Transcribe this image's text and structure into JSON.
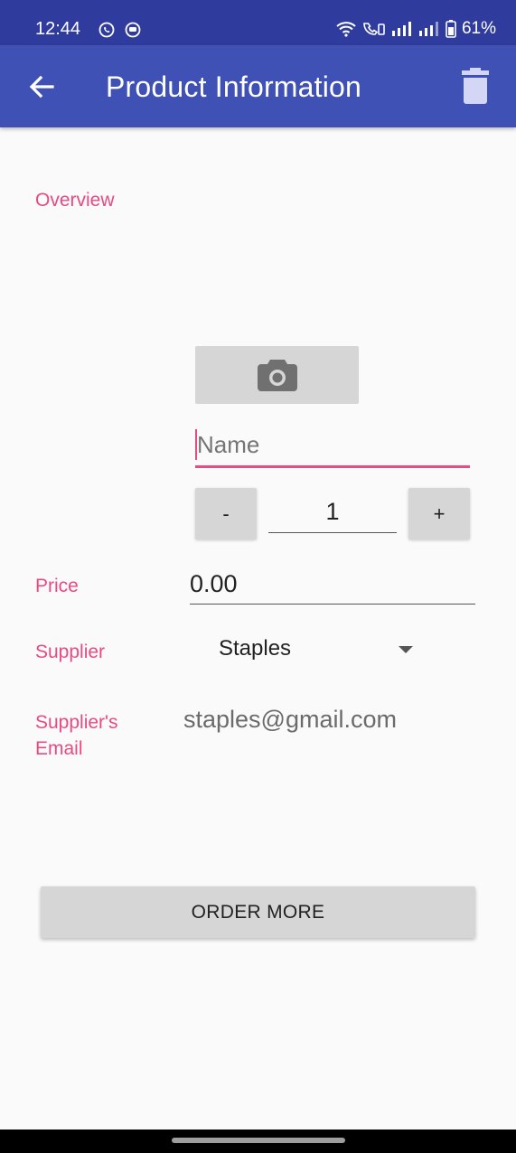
{
  "status_bar": {
    "time": "12:44",
    "left_icons": [
      "whatsapp-icon",
      "notification-app-icon"
    ],
    "right_icons": [
      "wifi-icon",
      "wifi-calling-icon",
      "signal-icon",
      "signal-icon",
      "battery-icon"
    ],
    "battery": "61%"
  },
  "app_bar": {
    "title": "Product Information",
    "back_icon": "arrow-back-icon",
    "delete_icon": "trash-icon",
    "color": "#3f51b5",
    "status_color": "#2f3c9e"
  },
  "overview": {
    "section_label": "Overview",
    "photo_icon": "camera-icon",
    "name_placeholder": "Name",
    "quantity": {
      "minus_label": "-",
      "value": "1",
      "plus_label": "+"
    }
  },
  "price": {
    "label": "Price",
    "value": "0.00"
  },
  "supplier": {
    "label": "Supplier",
    "value": "Staples"
  },
  "supplier_email": {
    "label": "Supplier's Email",
    "value": "staples@gmail.com"
  },
  "order_button": {
    "label": "ORDER MORE"
  },
  "accent_color": "#e84a82"
}
